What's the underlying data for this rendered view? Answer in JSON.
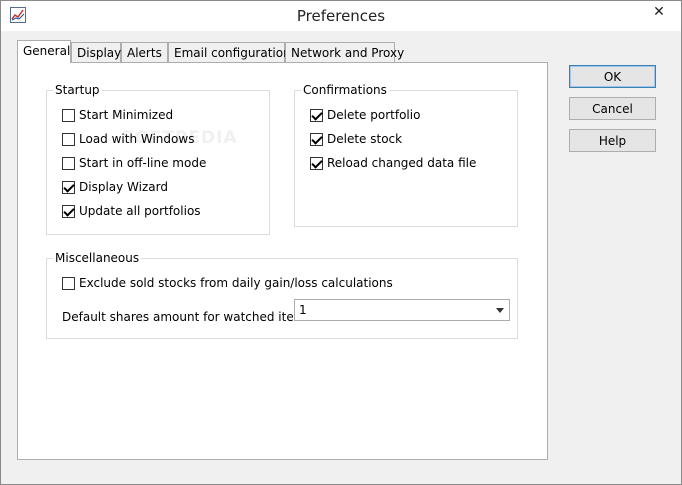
{
  "window": {
    "title": "Preferences"
  },
  "titlebar": {
    "close_glyph": "✕"
  },
  "tabs": [
    {
      "label": "General",
      "active": true
    },
    {
      "label": "Display",
      "active": false
    },
    {
      "label": "Alerts",
      "active": false
    },
    {
      "label": "Email configuration",
      "active": false
    },
    {
      "label": "Network and Proxy",
      "active": false
    }
  ],
  "startup": {
    "label": "Startup",
    "items": [
      {
        "label": "Start Minimized",
        "checked": false
      },
      {
        "label": "Load with Windows",
        "checked": false
      },
      {
        "label": "Start in off-line mode",
        "checked": false
      },
      {
        "label": "Display Wizard",
        "checked": true
      },
      {
        "label": "Update all portfolios",
        "checked": true
      }
    ]
  },
  "confirmations": {
    "label": "Confirmations",
    "items": [
      {
        "label": "Delete portfolio",
        "checked": true
      },
      {
        "label": "Delete stock",
        "checked": true
      },
      {
        "label": "Reload changed data file",
        "checked": true
      }
    ]
  },
  "misc": {
    "label": "Miscellaneous",
    "exclude_sold": {
      "label": "Exclude sold stocks from daily gain/loss calculations",
      "checked": false
    },
    "default_shares": {
      "label": "Default shares amount for watched items:",
      "value": "1"
    }
  },
  "buttons": {
    "ok": "OK",
    "cancel": "Cancel",
    "help": "Help"
  },
  "watermark": "SOFTPEDIA",
  "icons": {
    "app": "chart-icon",
    "close": "close-icon",
    "dropdown": "chevron-down-icon"
  }
}
